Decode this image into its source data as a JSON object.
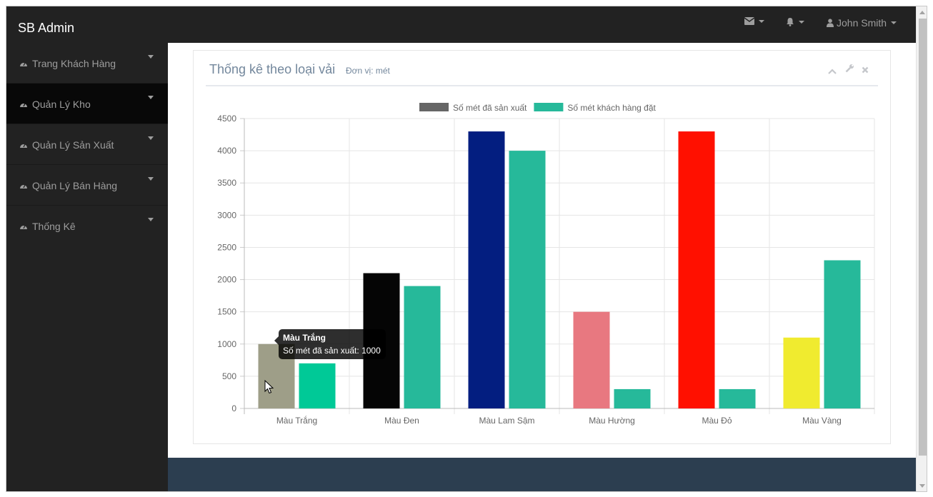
{
  "app": {
    "brand": "SB Admin"
  },
  "topnav": {
    "user_name": "John Smith"
  },
  "sidebar": {
    "items": [
      {
        "label": "Trang Khách Hàng"
      },
      {
        "label": "Quản Lý Kho"
      },
      {
        "label": "Quản Lý Sản Xuất"
      },
      {
        "label": "Quản Lý Bán Hàng"
      },
      {
        "label": "Thống Kê"
      }
    ]
  },
  "panel": {
    "title": "Thống kê theo loại vải",
    "subtitle": "Đơn vị: mét"
  },
  "tooltip": {
    "title": "Màu Trắng",
    "body": "Số mét đã sản xuất: 1000"
  },
  "colors": {
    "navbar": "#222222",
    "footer": "#2c3e50",
    "series2": "#26b99a"
  },
  "chart_data": {
    "type": "bar",
    "categories": [
      "Màu Trắng",
      "Màu Đen",
      "Màu Lam Sậm",
      "Màu Hường",
      "Màu Đỏ",
      "Màu Vàng"
    ],
    "series": [
      {
        "name": "Số mét đã sản xuất",
        "values": [
          1000,
          2100,
          4300,
          1500,
          4300,
          1100
        ],
        "colors": [
          "#9e9e88",
          "#050505",
          "#031e80",
          "#e87880",
          "#ff1000",
          "#f0eb2f"
        ],
        "legend_color": "#666666"
      },
      {
        "name": "Số mét khách hàng đặt",
        "values": [
          700,
          1900,
          4000,
          300,
          300,
          2300
        ],
        "colors": [
          "#00c997",
          "#26b99a",
          "#26b99a",
          "#26b99a",
          "#26b99a",
          "#26b99a"
        ],
        "legend_color": "#26b99a"
      }
    ],
    "yticks": [
      "0",
      "500",
      "1000",
      "1500",
      "2000",
      "2500",
      "3000",
      "3500",
      "4000",
      "4500"
    ],
    "ylim": [
      0,
      4500
    ],
    "legend_position": "top",
    "grid": true,
    "hovered": {
      "category": "Màu Trắng",
      "series": "Số mét đã sản xuất"
    }
  }
}
